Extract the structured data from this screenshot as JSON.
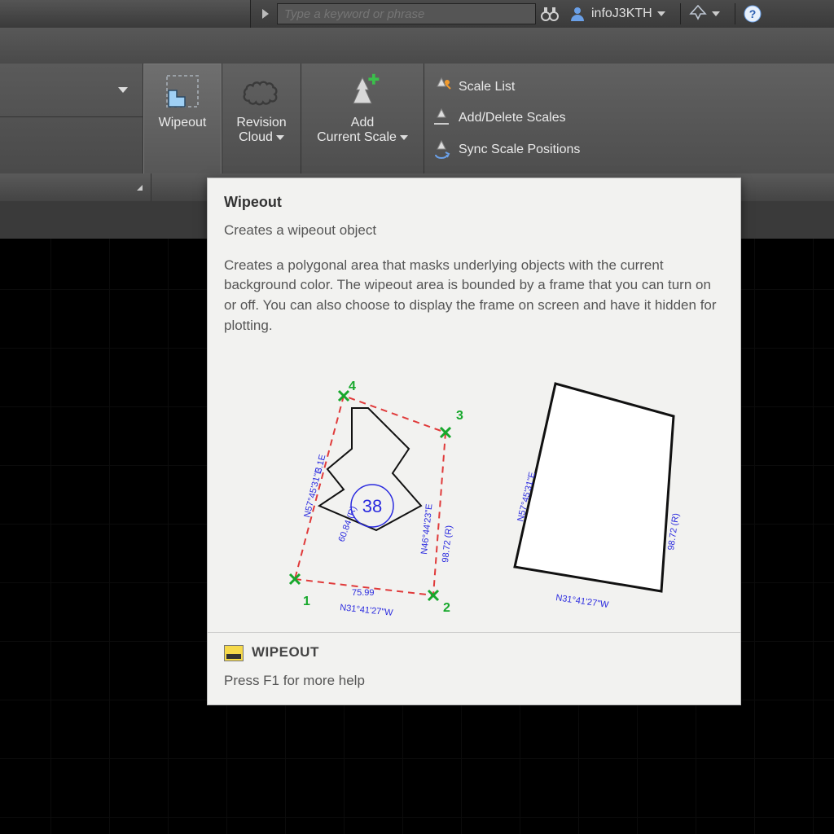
{
  "topbar": {
    "search_placeholder": "Type a keyword or phrase",
    "username": "infoJ3KTH"
  },
  "ribbon": {
    "wipeout": "Wipeout",
    "revision_cloud_l1": "Revision",
    "revision_cloud_l2": "Cloud",
    "add_current_l1": "Add",
    "add_current_l2": "Current Scale",
    "scale_list": "Scale List",
    "add_delete_scales": "Add/Delete Scales",
    "sync_scale_positions": "Sync Scale Positions"
  },
  "tooltip": {
    "title": "Wipeout",
    "subtitle": "Creates a wipeout object",
    "body": "Creates a polygonal area that masks underlying objects with the current background color. The wipeout area is bounded by a frame that you can turn on or off. You can also choose to display the frame on screen and have it hidden for plotting.",
    "command": "WIPEOUT",
    "help_hint": "Press F1 for more help"
  },
  "diagram": {
    "points": {
      "p1": "1",
      "p2": "2",
      "p3": "3",
      "p4": "4"
    },
    "dims": {
      "left_bearing": "N57°45'31\"E",
      "left_len": "3.1E",
      "under_house": "60.84 (R)",
      "lot_number": "38",
      "right_inner_bearing": "N46°44'23\"E",
      "right_len": "98.72 (R)",
      "bottom_len": "75.99",
      "bottom_bearing": "N31°41'27\"W",
      "r_left_bearing": "N57°45'31\"E",
      "r_right_len": "98.72 (R)",
      "r_bottom_bearing": "N31°41'27\"W"
    }
  }
}
